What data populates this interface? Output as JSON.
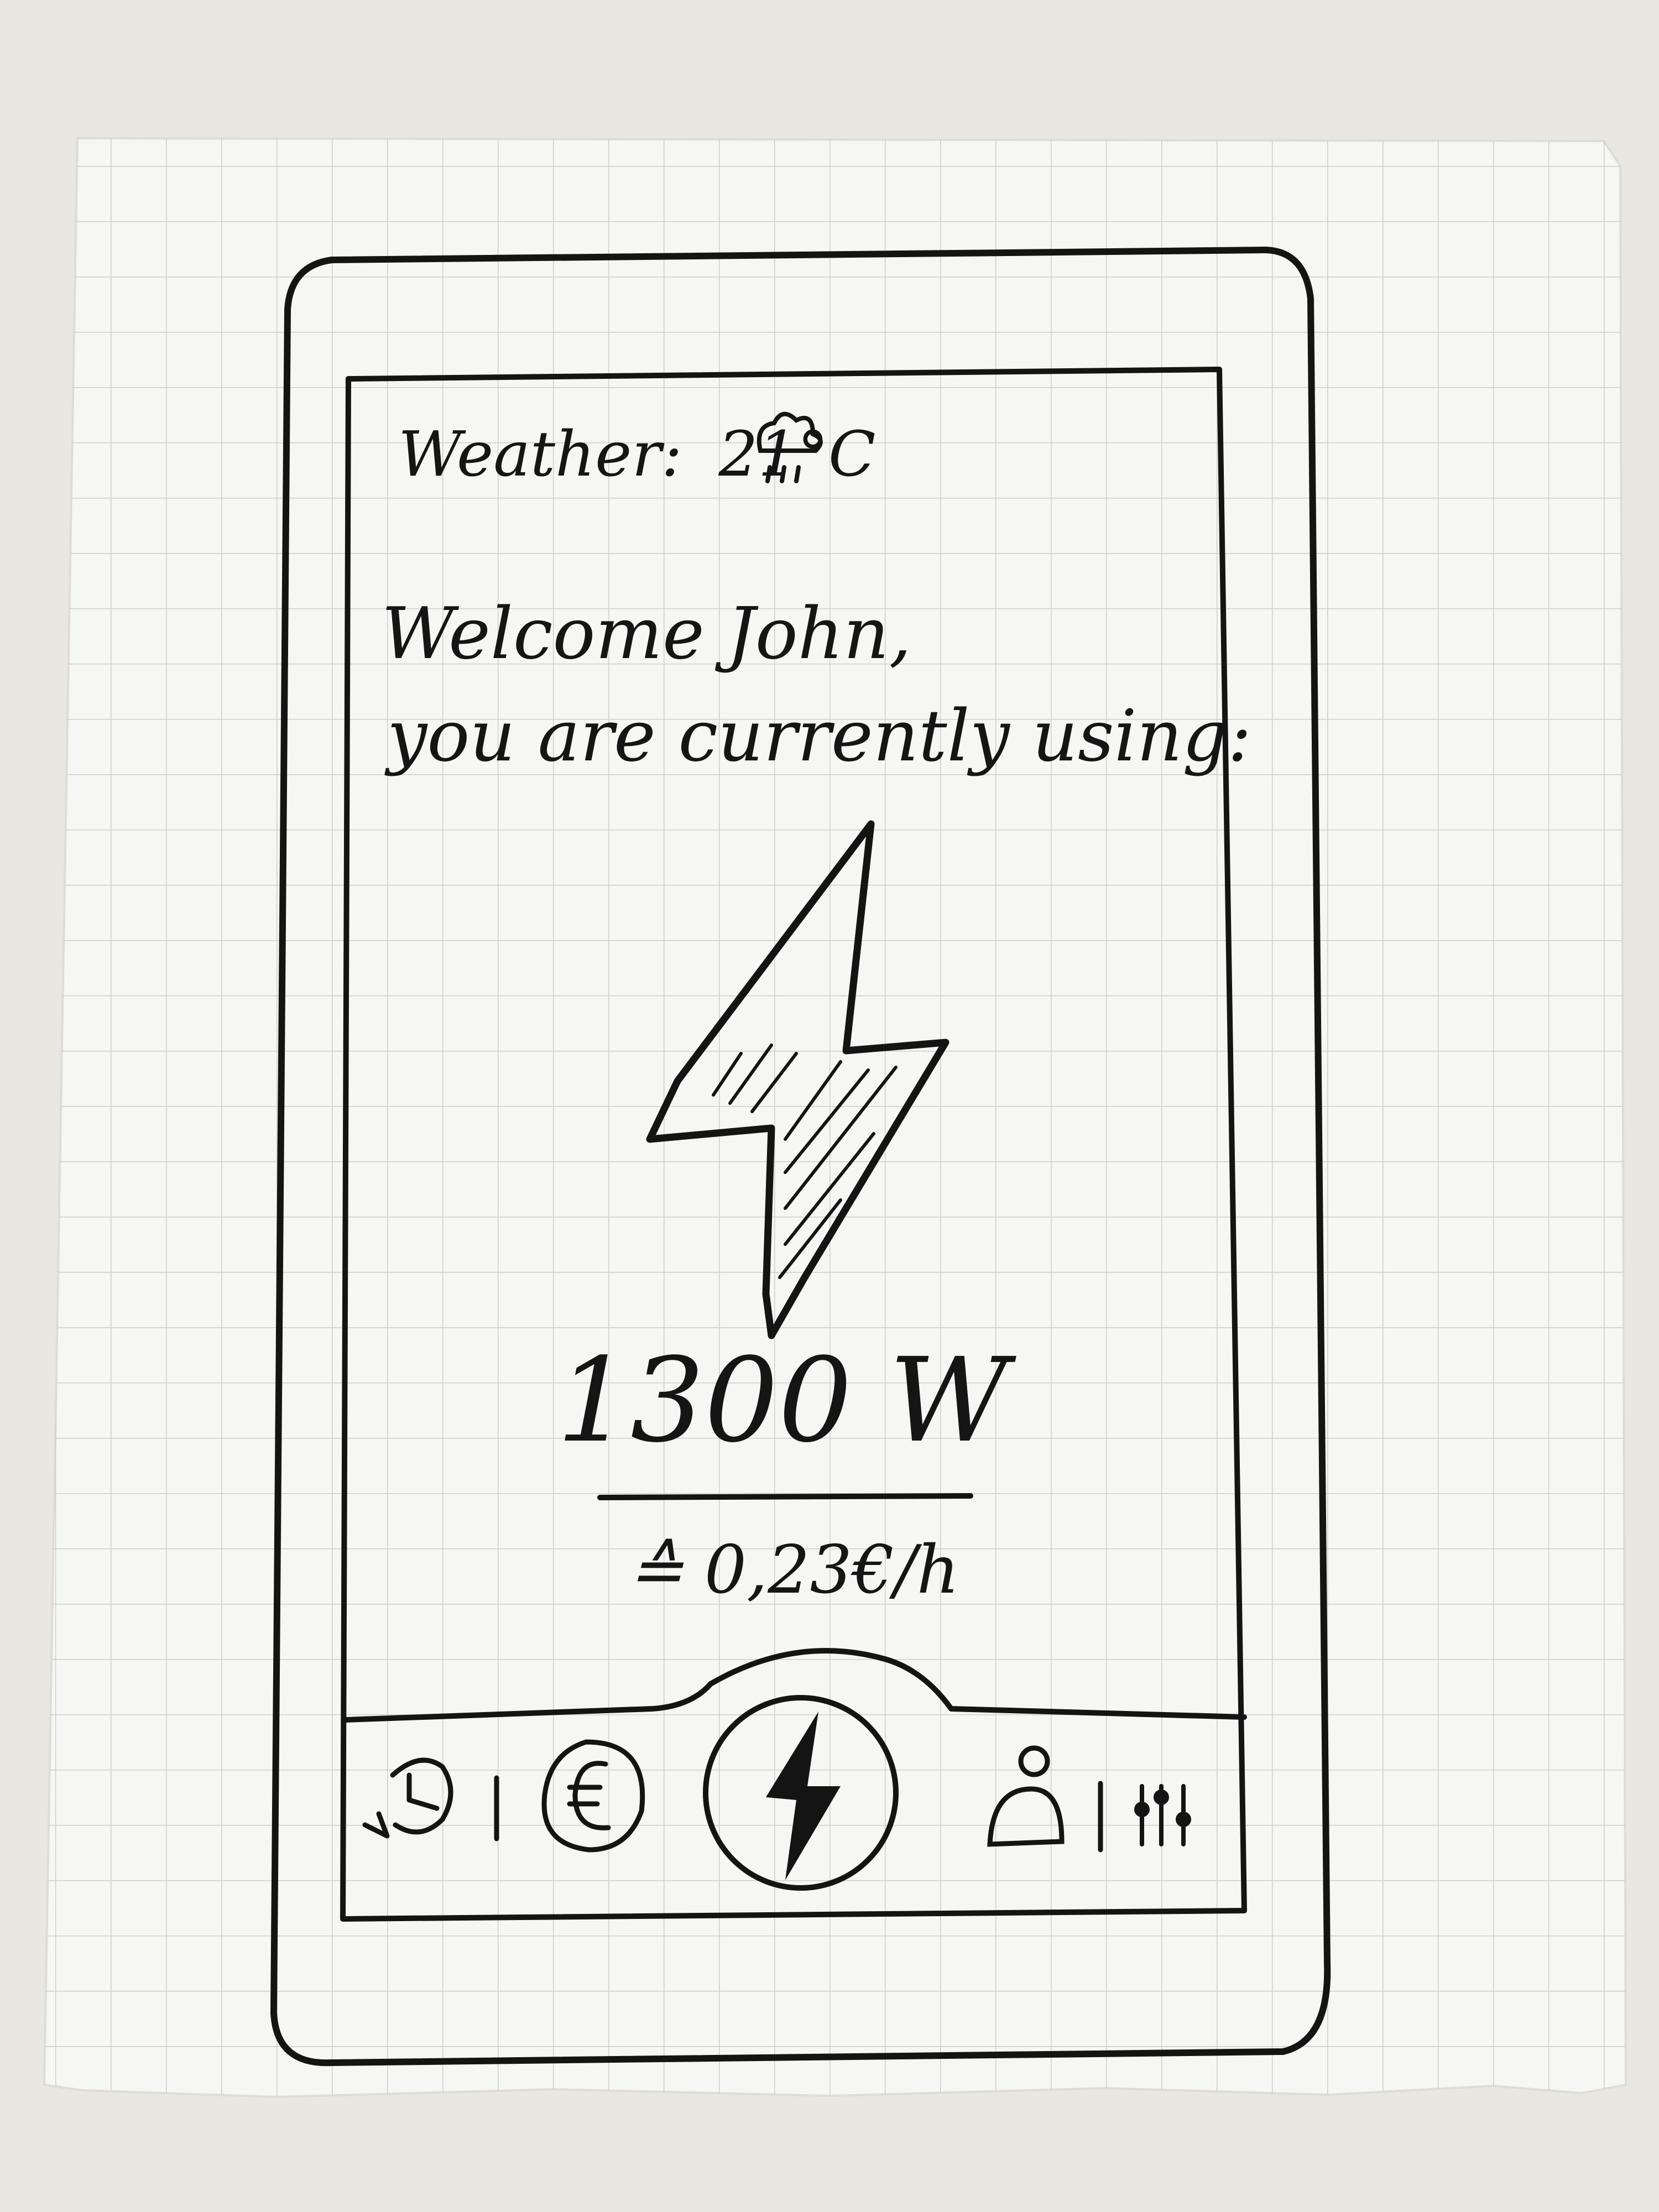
{
  "status": {
    "weather_label": "Weather:",
    "temperature": "21°C",
    "weather_icon": "rain-cloud-icon"
  },
  "greeting": {
    "line1": "Welcome John,",
    "line2": "you are currently using:"
  },
  "usage": {
    "hero_icon": "lightning-bolt-icon",
    "power": "1300 W",
    "cost": "≙ 0,23€/h"
  },
  "bottom_nav": {
    "items": [
      {
        "icon": "history-clock-icon"
      },
      {
        "icon": "divider"
      },
      {
        "icon": "euro-coin-icon"
      },
      {
        "icon": "lightning-bolt-icon"
      },
      {
        "icon": "user-profile-icon"
      },
      {
        "icon": "divider"
      },
      {
        "icon": "settings-sliders-icon"
      }
    ]
  }
}
